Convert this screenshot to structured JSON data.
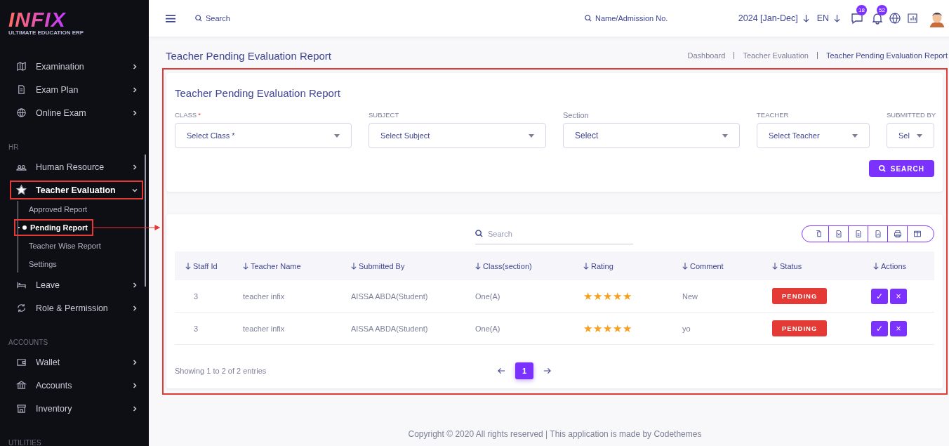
{
  "sidebar": {
    "logo": {
      "title": "INFIX",
      "subtitle": "ULTIMATE EDUCATION ERP"
    },
    "sections": [
      {
        "items": [
          {
            "label": "Examination",
            "expanded": false,
            "annotated": false
          },
          {
            "label": "Exam Plan",
            "expanded": false,
            "annotated": false
          },
          {
            "label": "Online Exam",
            "expanded": false,
            "annotated": false
          }
        ]
      },
      {
        "heading": "HR",
        "items": [
          {
            "label": "Human Resource",
            "expanded": false,
            "annotated": false
          },
          {
            "label": "Teacher Evaluation",
            "expanded": true,
            "annotated": true,
            "children": [
              {
                "label": "Approved Report",
                "selected": false,
                "annotated": false
              },
              {
                "label": "Pending Report",
                "selected": true,
                "annotated": true
              },
              {
                "label": "Teacher Wise Report",
                "selected": false,
                "annotated": false
              },
              {
                "label": "Settings",
                "selected": false,
                "annotated": false
              }
            ]
          },
          {
            "label": "Leave",
            "expanded": false,
            "annotated": false
          },
          {
            "label": "Role & Permission",
            "expanded": false,
            "annotated": false
          }
        ]
      },
      {
        "heading": "ACCOUNTS",
        "items": [
          {
            "label": "Wallet",
            "expanded": false,
            "annotated": false
          },
          {
            "label": "Accounts",
            "expanded": false,
            "annotated": false
          },
          {
            "label": "Inventory",
            "expanded": false,
            "annotated": false
          }
        ]
      },
      {
        "heading": "UTILITIES"
      }
    ]
  },
  "topbar": {
    "search": {
      "placeholder": "Search"
    },
    "student_search": {
      "placeholder": "Name/Admission No."
    },
    "session": "2024 [Jan-Dec]",
    "language": "EN",
    "message_count": "18",
    "notification_count": "52"
  },
  "page": {
    "title": "Teacher Pending Evaluation Report",
    "breadcrumb": [
      "Dashboard",
      "Teacher Evaluation",
      "Teacher Pending Evaluation Report"
    ],
    "annotated": true
  },
  "filter": {
    "title": "Teacher Pending Evaluation Report",
    "fields": [
      {
        "label": "CLASS",
        "required_mark": "*",
        "placeholder": "Select Class *",
        "kind": "caps"
      },
      {
        "label": "SUBJECT",
        "placeholder": "Select Subject",
        "kind": "caps"
      },
      {
        "label": "Section",
        "placeholder": "Select",
        "kind": "plain"
      },
      {
        "label": "TEACHER",
        "placeholder": "Select Teacher",
        "kind": "caps"
      },
      {
        "label": "SUBMITTED BY",
        "placeholder": "Sel",
        "kind": "caps"
      }
    ],
    "button": "SEARCH"
  },
  "table": {
    "search": {
      "placeholder": "Search"
    },
    "columns": [
      "Staff Id",
      "Teacher Name",
      "Submitted By",
      "Class(section)",
      "Rating",
      "Comment",
      "Status",
      "Actions"
    ],
    "rows": [
      {
        "staff_id": "3",
        "teacher_name": "teacher infix",
        "submitted_by": "AISSA ABDA(Student)",
        "class_section": "One(A)",
        "stars": 5,
        "comment": "New",
        "status": "PENDING",
        "approve": "✓",
        "reject": "×"
      },
      {
        "staff_id": "3",
        "teacher_name": "teacher infix",
        "submitted_by": "AISSA ABDA(Student)",
        "class_section": "One(A)",
        "stars": 5,
        "comment": "yo",
        "status": "PENDING",
        "approve": "✓",
        "reject": "×"
      }
    ],
    "info": "Showing 1 to 2 of 2 entries",
    "pages": [
      {
        "label": "1",
        "selected": true
      }
    ]
  },
  "footer": "Copyright © 2020 All rights reserved | This application is made by Codethemes"
}
